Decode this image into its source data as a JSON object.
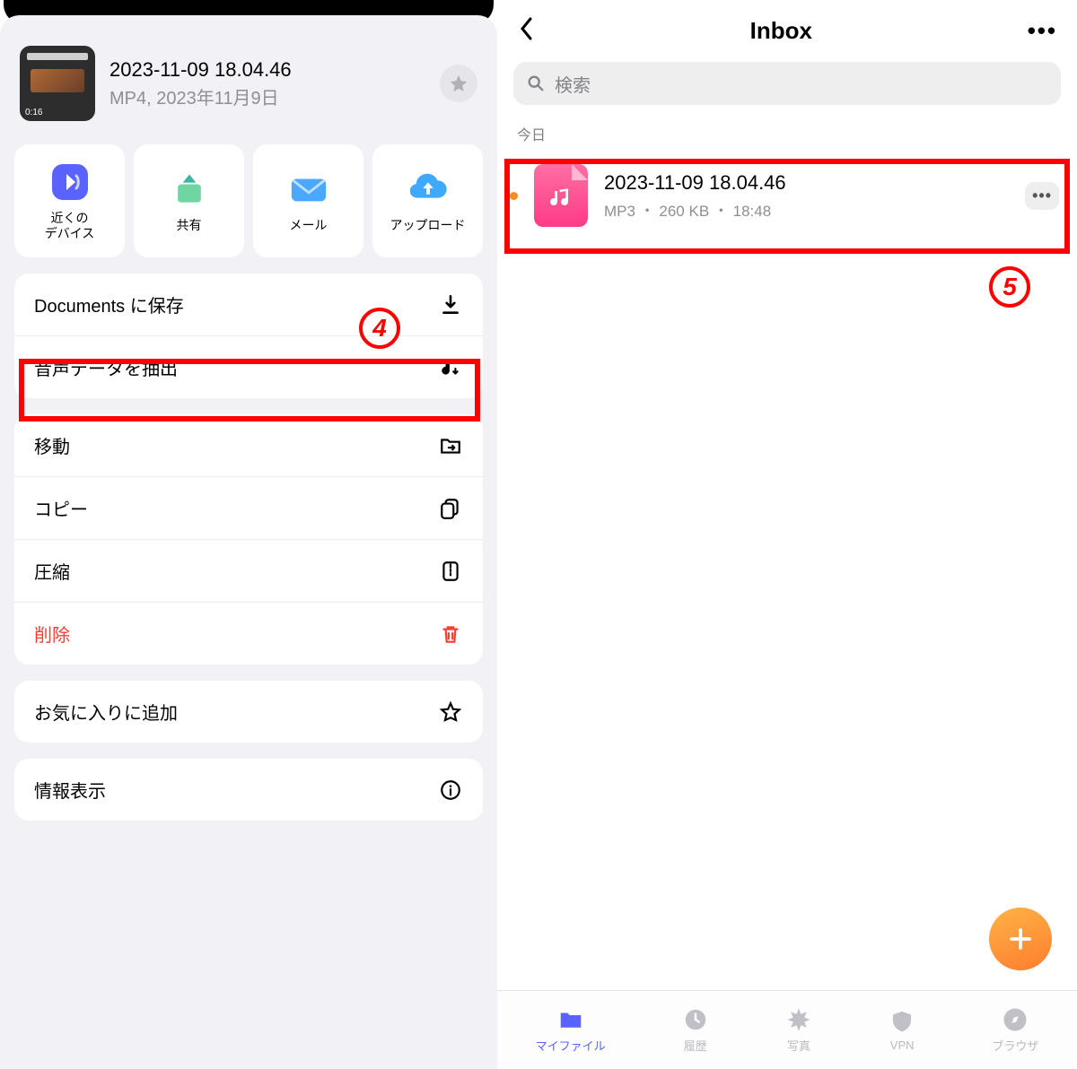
{
  "left": {
    "thumb_duration": "0:16",
    "file_title": "2023-11-09 18.04.46",
    "file_subtitle": "MP4, 2023年11月9日",
    "share": [
      {
        "label": "近くの\nデバイス",
        "icon": "nearby"
      },
      {
        "label": "共有",
        "icon": "share"
      },
      {
        "label": "メール",
        "icon": "mail"
      },
      {
        "label": "アップロード",
        "icon": "cloud"
      }
    ],
    "group1": [
      {
        "label": "Documents に保存",
        "icon": "download"
      },
      {
        "label": "音声データを抽出",
        "icon": "music-dl"
      }
    ],
    "group2": [
      {
        "label": "移動",
        "icon": "folder"
      },
      {
        "label": "コピー",
        "icon": "copy"
      },
      {
        "label": "圧縮",
        "icon": "zip"
      },
      {
        "label": "削除",
        "icon": "trash",
        "danger": true
      }
    ],
    "group3": [
      {
        "label": "お気に入りに追加",
        "icon": "star"
      }
    ],
    "group4": [
      {
        "label": "情報表示",
        "icon": "info"
      }
    ],
    "callout_number": "4"
  },
  "right": {
    "title": "Inbox",
    "search_placeholder": "検索",
    "section": "今日",
    "file": {
      "title": "2023-11-09 18.04.46",
      "subtitle": "MP3 ・ 260 KB ・ 18:48"
    },
    "callout_number": "5",
    "tabs": [
      {
        "label": "マイファイル",
        "icon": "folder",
        "active": true
      },
      {
        "label": "履歴",
        "icon": "clock"
      },
      {
        "label": "写真",
        "icon": "flower"
      },
      {
        "label": "VPN",
        "icon": "shield"
      },
      {
        "label": "ブラウザ",
        "icon": "compass"
      }
    ]
  }
}
